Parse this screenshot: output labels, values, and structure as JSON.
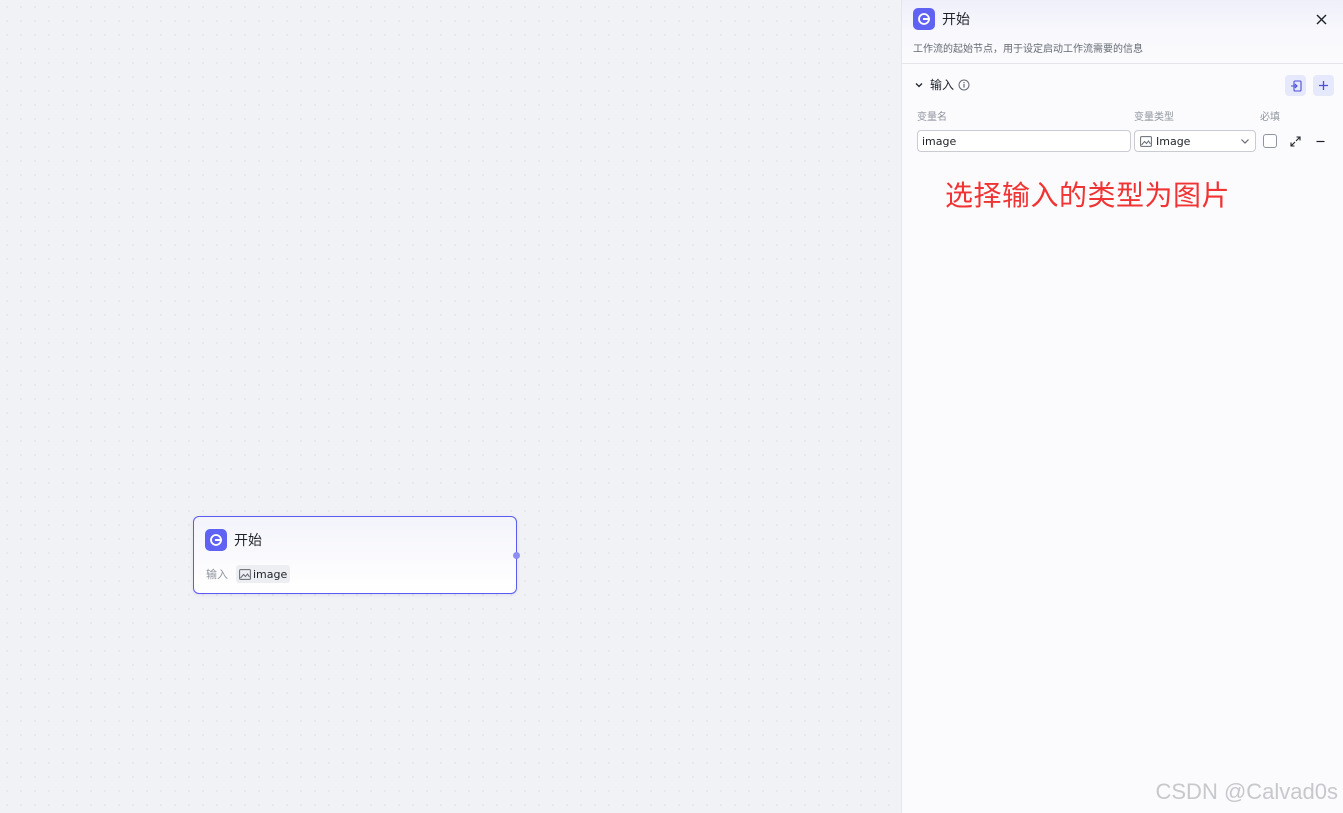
{
  "canvas": {
    "node": {
      "title": "开始",
      "input_label": "输入",
      "variable": "image"
    }
  },
  "panel": {
    "title": "开始",
    "description": "工作流的起始节点，用于设定启动工作流需要的信息",
    "section": {
      "title": "输入"
    },
    "columns": {
      "name": "变量名",
      "type": "变量类型",
      "required": "必填"
    },
    "row": {
      "name_value": "image",
      "type_value": "Image"
    },
    "annotation": "选择输入的类型为图片"
  },
  "watermark": "CSDN @Calvad0s",
  "colors": {
    "accent": "#6062f4",
    "annotation": "#f03333"
  }
}
